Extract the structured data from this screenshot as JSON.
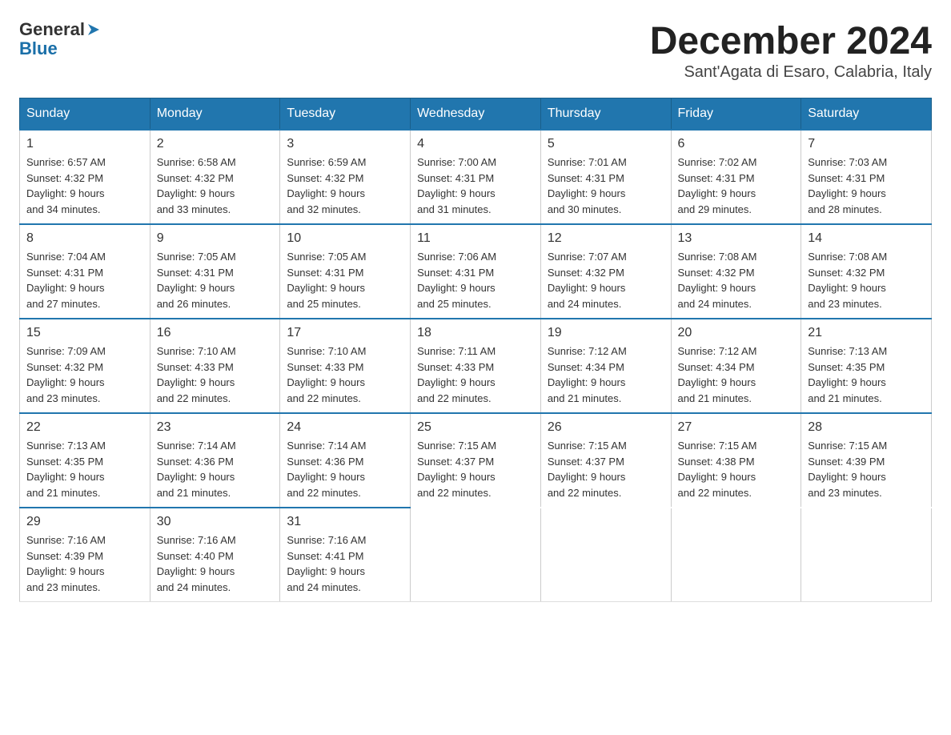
{
  "header": {
    "logo_general": "General",
    "logo_blue": "Blue",
    "month_year": "December 2024",
    "location": "Sant'Agata di Esaro, Calabria, Italy"
  },
  "weekdays": [
    "Sunday",
    "Monday",
    "Tuesday",
    "Wednesday",
    "Thursday",
    "Friday",
    "Saturday"
  ],
  "weeks": [
    [
      {
        "day": "1",
        "sunrise": "6:57 AM",
        "sunset": "4:32 PM",
        "daylight": "9 hours and 34 minutes."
      },
      {
        "day": "2",
        "sunrise": "6:58 AM",
        "sunset": "4:32 PM",
        "daylight": "9 hours and 33 minutes."
      },
      {
        "day": "3",
        "sunrise": "6:59 AM",
        "sunset": "4:32 PM",
        "daylight": "9 hours and 32 minutes."
      },
      {
        "day": "4",
        "sunrise": "7:00 AM",
        "sunset": "4:31 PM",
        "daylight": "9 hours and 31 minutes."
      },
      {
        "day": "5",
        "sunrise": "7:01 AM",
        "sunset": "4:31 PM",
        "daylight": "9 hours and 30 minutes."
      },
      {
        "day": "6",
        "sunrise": "7:02 AM",
        "sunset": "4:31 PM",
        "daylight": "9 hours and 29 minutes."
      },
      {
        "day": "7",
        "sunrise": "7:03 AM",
        "sunset": "4:31 PM",
        "daylight": "9 hours and 28 minutes."
      }
    ],
    [
      {
        "day": "8",
        "sunrise": "7:04 AM",
        "sunset": "4:31 PM",
        "daylight": "9 hours and 27 minutes."
      },
      {
        "day": "9",
        "sunrise": "7:05 AM",
        "sunset": "4:31 PM",
        "daylight": "9 hours and 26 minutes."
      },
      {
        "day": "10",
        "sunrise": "7:05 AM",
        "sunset": "4:31 PM",
        "daylight": "9 hours and 25 minutes."
      },
      {
        "day": "11",
        "sunrise": "7:06 AM",
        "sunset": "4:31 PM",
        "daylight": "9 hours and 25 minutes."
      },
      {
        "day": "12",
        "sunrise": "7:07 AM",
        "sunset": "4:32 PM",
        "daylight": "9 hours and 24 minutes."
      },
      {
        "day": "13",
        "sunrise": "7:08 AM",
        "sunset": "4:32 PM",
        "daylight": "9 hours and 24 minutes."
      },
      {
        "day": "14",
        "sunrise": "7:08 AM",
        "sunset": "4:32 PM",
        "daylight": "9 hours and 23 minutes."
      }
    ],
    [
      {
        "day": "15",
        "sunrise": "7:09 AM",
        "sunset": "4:32 PM",
        "daylight": "9 hours and 23 minutes."
      },
      {
        "day": "16",
        "sunrise": "7:10 AM",
        "sunset": "4:33 PM",
        "daylight": "9 hours and 22 minutes."
      },
      {
        "day": "17",
        "sunrise": "7:10 AM",
        "sunset": "4:33 PM",
        "daylight": "9 hours and 22 minutes."
      },
      {
        "day": "18",
        "sunrise": "7:11 AM",
        "sunset": "4:33 PM",
        "daylight": "9 hours and 22 minutes."
      },
      {
        "day": "19",
        "sunrise": "7:12 AM",
        "sunset": "4:34 PM",
        "daylight": "9 hours and 21 minutes."
      },
      {
        "day": "20",
        "sunrise": "7:12 AM",
        "sunset": "4:34 PM",
        "daylight": "9 hours and 21 minutes."
      },
      {
        "day": "21",
        "sunrise": "7:13 AM",
        "sunset": "4:35 PM",
        "daylight": "9 hours and 21 minutes."
      }
    ],
    [
      {
        "day": "22",
        "sunrise": "7:13 AM",
        "sunset": "4:35 PM",
        "daylight": "9 hours and 21 minutes."
      },
      {
        "day": "23",
        "sunrise": "7:14 AM",
        "sunset": "4:36 PM",
        "daylight": "9 hours and 21 minutes."
      },
      {
        "day": "24",
        "sunrise": "7:14 AM",
        "sunset": "4:36 PM",
        "daylight": "9 hours and 22 minutes."
      },
      {
        "day": "25",
        "sunrise": "7:15 AM",
        "sunset": "4:37 PM",
        "daylight": "9 hours and 22 minutes."
      },
      {
        "day": "26",
        "sunrise": "7:15 AM",
        "sunset": "4:37 PM",
        "daylight": "9 hours and 22 minutes."
      },
      {
        "day": "27",
        "sunrise": "7:15 AM",
        "sunset": "4:38 PM",
        "daylight": "9 hours and 22 minutes."
      },
      {
        "day": "28",
        "sunrise": "7:15 AM",
        "sunset": "4:39 PM",
        "daylight": "9 hours and 23 minutes."
      }
    ],
    [
      {
        "day": "29",
        "sunrise": "7:16 AM",
        "sunset": "4:39 PM",
        "daylight": "9 hours and 23 minutes."
      },
      {
        "day": "30",
        "sunrise": "7:16 AM",
        "sunset": "4:40 PM",
        "daylight": "9 hours and 24 minutes."
      },
      {
        "day": "31",
        "sunrise": "7:16 AM",
        "sunset": "4:41 PM",
        "daylight": "9 hours and 24 minutes."
      },
      null,
      null,
      null,
      null
    ]
  ],
  "labels": {
    "sunrise": "Sunrise:",
    "sunset": "Sunset:",
    "daylight": "Daylight:"
  },
  "colors": {
    "header_bg": "#2176ae",
    "accent": "#1a6fa8"
  }
}
